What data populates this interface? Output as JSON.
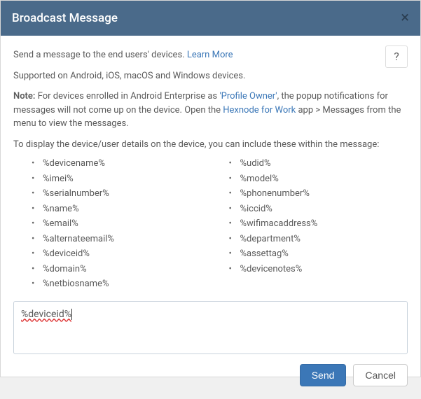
{
  "header": {
    "title": "Broadcast Message"
  },
  "help": {
    "symbol": "?"
  },
  "intro": {
    "text": "Send a message to the end users' devices. ",
    "learnMore": "Learn More"
  },
  "supported": "Supported on Android, iOS, macOS and Windows devices.",
  "note": {
    "label": "Note:",
    "part1": " For devices enrolled in Android Enterprise as ",
    "profileOwner": "'Profile Owner'",
    "part2": ", the popup notifications for messages will not come up on the device. Open the ",
    "appLink": "Hexnode for Work",
    "part3": " app > Messages from the menu to view the messages."
  },
  "placeholdersIntro": "To display the device/user details on the device, you can include these within the message:",
  "placeholdersLeft": [
    "%devicename%",
    "%imei%",
    "%serialnumber%",
    "%name%",
    "%email%",
    "%alternateemail%",
    "%deviceid%",
    "%domain%",
    "%netbiosname%"
  ],
  "placeholdersRight": [
    "%udid%",
    "%model%",
    "%phonenumber%",
    "%iccid%",
    "%wifimacaddress%",
    "%department%",
    "%assettag%",
    "%devicenotes%"
  ],
  "message": {
    "value": "%deviceid%"
  },
  "buttons": {
    "send": "Send",
    "cancel": "Cancel"
  }
}
